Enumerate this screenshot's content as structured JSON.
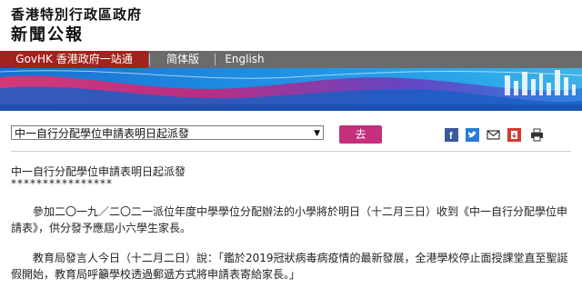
{
  "header": {
    "line1": "香港特別行政區政府",
    "line2": "新聞公報"
  },
  "nav": {
    "govhk": "GovHK 香港政府一站通",
    "simplified": "简体版",
    "english": "English"
  },
  "controls": {
    "select_value": "中一自行分配學位申請表明日起派發",
    "go_label": "去"
  },
  "icons": [
    "facebook-icon",
    "twitter-icon",
    "mail-icon",
    "download-icon",
    "print-icon"
  ],
  "colors": {
    "govhk_bg": "#a2231d",
    "nav_bg": "#6b6b6b",
    "go_button": "#c4307c"
  },
  "article": {
    "title": "中一自行分配學位申請表明日起派發",
    "stars": "****************",
    "para1": "　　參加二〇一九／二〇二一派位年度中學學位分配辦法的小學將於明日（十二月三日）收到《中一自行分配學位申請表》，供分發予應屆小六學生家長。",
    "para2": "　　教育局發言人今日（十二月二日）說：「鑑於2019冠狀病毒病疫情的最新發展，全港學校停止面授課堂直至聖誕假開始，教育局呼籲學校透過郵遞方式將申請表寄給家長。」"
  }
}
